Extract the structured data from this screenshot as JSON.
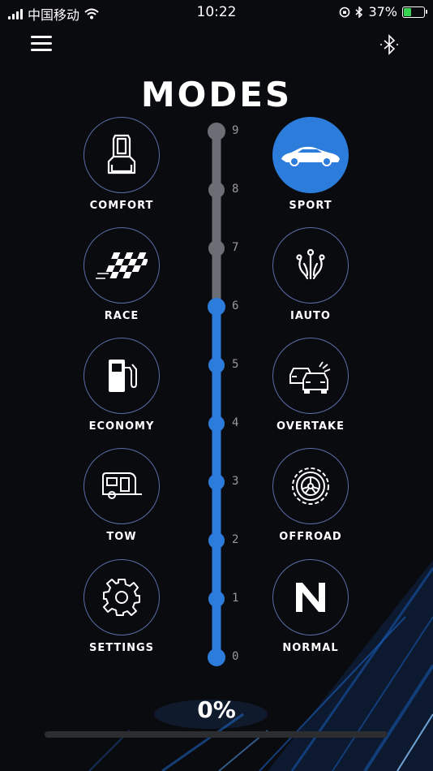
{
  "status_bar": {
    "carrier": "中国移动",
    "time": "10:22",
    "battery": "37%"
  },
  "header": {
    "title": "MODES"
  },
  "modes_left": [
    {
      "label": "COMFORT",
      "icon": "seat-icon"
    },
    {
      "label": "RACE",
      "icon": "checkered-flag-icon"
    },
    {
      "label": "ECONOMY",
      "icon": "fuel-pump-icon"
    },
    {
      "label": "TOW",
      "icon": "trailer-icon"
    },
    {
      "label": "SETTINGS",
      "icon": "gear-icon"
    }
  ],
  "modes_right": [
    {
      "label": "SPORT",
      "icon": "sport-car-icon",
      "active": true
    },
    {
      "label": "IAUTO",
      "icon": "iauto-icon"
    },
    {
      "label": "OVERTAKE",
      "icon": "overtake-cars-icon"
    },
    {
      "label": "OFFROAD",
      "icon": "offroad-wheel-icon"
    },
    {
      "label": "NORMAL",
      "icon": "n-letter-icon"
    }
  ],
  "slider": {
    "ticks": [
      "9",
      "8",
      "7",
      "6",
      "5",
      "4",
      "3",
      "2",
      "1",
      "0"
    ],
    "level": 6,
    "max": 9
  },
  "progress": {
    "label": "0%",
    "value": 0
  },
  "colors": {
    "accent": "#2c7cdb",
    "inactive_track": "#6b6e74",
    "ring": "#5a6da8"
  }
}
